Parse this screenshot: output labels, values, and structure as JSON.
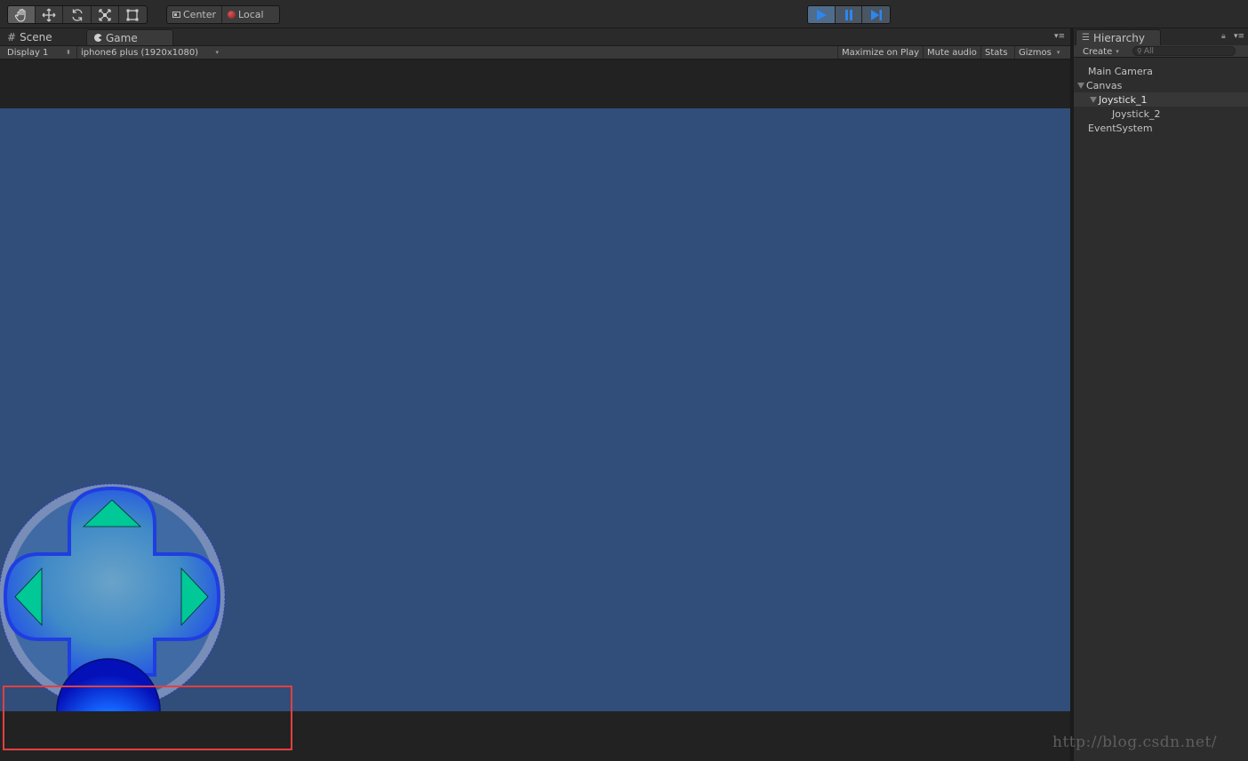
{
  "toolbar": {
    "transform_tools": [
      "hand-tool-icon",
      "move-tool-icon",
      "rotate-tool-icon",
      "scale-tool-icon",
      "rect-tool-icon"
    ],
    "pivot_label": "Center",
    "space_label": "Local",
    "play_controls": [
      "play-icon",
      "pause-icon",
      "step-icon"
    ]
  },
  "game_panel": {
    "scene_tab": "Scene",
    "game_tab": "Game",
    "display_label": "Display 1",
    "resolution_label": "iphone6 plus (1920x1080)",
    "maximize_label": "Maximize on Play",
    "mute_label": "Mute audio",
    "stats_label": "Stats",
    "gizmos_label": "Gizmos",
    "viewport_color": "#314d79"
  },
  "hierarchy": {
    "tab_label": "Hierarchy",
    "create_label": "Create",
    "search_placeholder": "All",
    "items": [
      {
        "label": "Main Camera"
      },
      {
        "label": "Canvas"
      },
      {
        "label": "Joystick_1"
      },
      {
        "label": "Joystick_2"
      },
      {
        "label": "EventSystem"
      }
    ]
  },
  "watermark": "http://blog.csdn.net/",
  "colors": {
    "highlight": "#e34040",
    "arrow": "#00c896",
    "dpad_border": "#1f3ee0"
  }
}
